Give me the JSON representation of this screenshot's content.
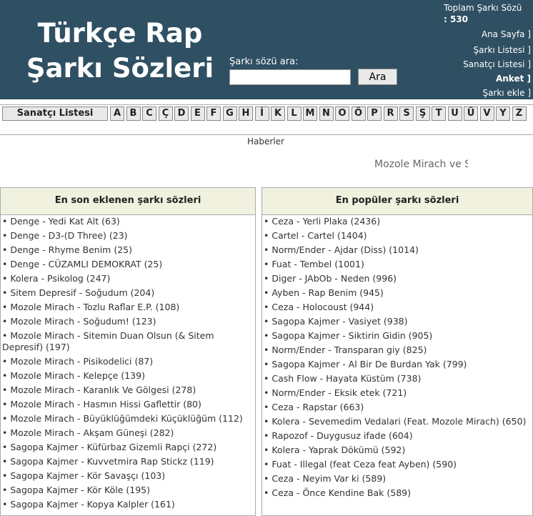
{
  "header": {
    "title_line1": "Türkçe Rap",
    "title_line2": "Şarkı Sözleri",
    "search_label": "Şarkı sözü ara:",
    "search_value": "",
    "search_button": "Ara",
    "total_label": "Toplam Şarkı Sözü",
    "total_count": ": 530",
    "nav": [
      "Ana Sayfa ]",
      "Şarkı Listesi ]",
      "Sanatçı Listesi ]",
      "Anket ]",
      "Şarkı ekle ]"
    ]
  },
  "alphabet": {
    "artist_list_label": "Sanatçı Listesi",
    "letters": [
      "A",
      "B",
      "C",
      "Ç",
      "D",
      "E",
      "F",
      "G",
      "H",
      "İ",
      "K",
      "L",
      "M",
      "N",
      "O",
      "Ö",
      "P",
      "R",
      "S",
      "Ş",
      "T",
      "U",
      "Ü",
      "V",
      "Y",
      "Z"
    ]
  },
  "news": {
    "label": "Haberler",
    "marquee": "Mozole Mirach ve S"
  },
  "latest": {
    "title": "En son eklenen şarkı sözleri",
    "items": [
      "Denge - Yedi Kat Alt (63)",
      "Denge - D3-(D Three) (23)",
      "Denge - Rhyme Benim (25)",
      "Denge - CÜZAMLI DEMOKRAT (25)",
      "Kolera - Psikolog (247)",
      "Sitem Depresif - Soğudum (204)",
      "Mozole Mirach - Tozlu Raflar E.P. (108)",
      "Mozole Mirach - Soğudum! (123)",
      "Mozole Mirach - Sitemin Duan Olsun (& Sitem Depresif) (197)",
      "Mozole Mirach - Pisikodelici (87)",
      "Mozole Mirach - Kelepçe (139)",
      "Mozole Mirach - Karanlık Ve Gölgesi (278)",
      "Mozole Mirach - Hasmın Hissi Gaflettir (80)",
      "Mozole Mirach - Büyüklüğümdeki Küçüklüğüm (112)",
      "Mozole Mirach - Akşam Güneşi (282)",
      "Sagopa Kajmer - Küfürbaz Gizemli Rapçi (272)",
      "Sagopa Kajmer - Kuvvetmira Rap Stickz (119)",
      "Sagopa Kajmer - Kör Savaşçı (103)",
      "Sagopa Kajmer - Kör Köle (195)",
      "Sagopa Kajmer - Kopya Kalpler (161)"
    ]
  },
  "popular": {
    "title": "En popüler şarkı sözleri",
    "items": [
      "Ceza - Yerli Plaka (2436)",
      "Cartel - Cartel (1404)",
      "Norm/Ender - Ajdar (Diss) (1014)",
      "Fuat - Tembel (1001)",
      "Diger - JAbOb - Neden (996)",
      "Ayben - Rap Benim (945)",
      "Ceza - Holocoust (944)",
      "Sagopa Kajmer - Vasiyet (938)",
      "Sagopa Kajmer - Siktirin Gidin (905)",
      "Norm/Ender - Transparan giy (825)",
      "Sagopa Kajmer - Al Bir De Burdan Yak (799)",
      "Cash Flow - Hayata Küstüm (738)",
      "Norm/Ender - Eksik etek (721)",
      "Ceza - Rapstar (663)",
      "Kolera - Sevemedim Vedalari (Feat. Mozole Mirach) (650)",
      "Rapozof - Duygusuz ifade (604)",
      "Kolera - Yaprak Dökümü (592)",
      "Fuat - Illegal (feat Ceza feat Ayben) (590)",
      "Ceza - Neyim Var ki (589)",
      "Ceza - Önce Kendine Bak (589)"
    ]
  },
  "colors": {
    "header_bg": "#2f4f62",
    "panel_head_bg": "#f0f1df"
  }
}
